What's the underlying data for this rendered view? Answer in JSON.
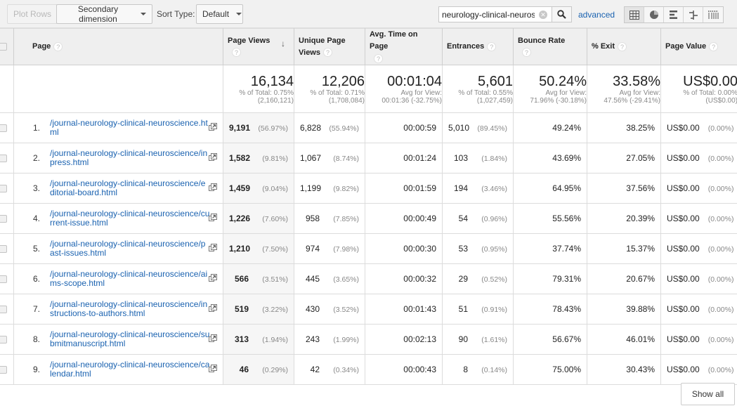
{
  "toolbar": {
    "plot_rows": "Plot Rows",
    "secondary_dimension": "Secondary dimension",
    "sort_type_label": "Sort Type:",
    "sort_type_value": "Default",
    "search_value": "neurology-clinical-neurosc",
    "advanced": "advanced",
    "view_modes": [
      "table",
      "pie",
      "performance",
      "comparison",
      "pivot"
    ],
    "active_view": "table"
  },
  "columns": {
    "page": "Page",
    "pageviews": "Page Views",
    "unique": "Unique Page Views",
    "avg_time": "Avg. Time on Page",
    "entrances": "Entrances",
    "bounce": "Bounce Rate",
    "exit": "% Exit",
    "value": "Page Value"
  },
  "summary": {
    "pageviews": {
      "value": "16,134",
      "line1": "% of Total: 0.75%",
      "line2": "(2,160,121)"
    },
    "unique": {
      "value": "12,206",
      "line1": "% of Total: 0.71%",
      "line2": "(1,708,084)"
    },
    "avg_time": {
      "value": "00:01:04",
      "line1": "Avg for View:",
      "line2": "00:01:36 (-32.75%)"
    },
    "entrances": {
      "value": "5,601",
      "line1": "% of Total: 0.55%",
      "line2": "(1,027,459)"
    },
    "bounce": {
      "value": "50.24%",
      "line1": "Avg for View:",
      "line2": "71.96% (-30.18%)"
    },
    "exit": {
      "value": "33.58%",
      "line1": "Avg for View:",
      "line2": "47.56% (-29.41%)"
    },
    "value": {
      "value": "US$0.00",
      "line1": "% of Total: 0.00%",
      "line2": "(US$0.00)"
    }
  },
  "rows": [
    {
      "idx": "1.",
      "page": "/journal-neurology-clinical-neuroscience.html",
      "pv": "9,191",
      "pv_pct": "(56.97%)",
      "upv": "6,828",
      "upv_pct": "(55.94%)",
      "time": "00:00:59",
      "ent": "5,010",
      "ent_pct": "(89.45%)",
      "bounce": "49.24%",
      "exit": "38.25%",
      "val": "US$0.00",
      "val_pct": "(0.00%)"
    },
    {
      "idx": "2.",
      "page": "/journal-neurology-clinical-neuroscience/inpress.html",
      "pv": "1,582",
      "pv_pct": "(9.81%)",
      "upv": "1,067",
      "upv_pct": "(8.74%)",
      "time": "00:01:24",
      "ent": "103",
      "ent_pct": "(1.84%)",
      "bounce": "43.69%",
      "exit": "27.05%",
      "val": "US$0.00",
      "val_pct": "(0.00%)"
    },
    {
      "idx": "3.",
      "page": "/journal-neurology-clinical-neuroscience/editorial-board.html",
      "pv": "1,459",
      "pv_pct": "(9.04%)",
      "upv": "1,199",
      "upv_pct": "(9.82%)",
      "time": "00:01:59",
      "ent": "194",
      "ent_pct": "(3.46%)",
      "bounce": "64.95%",
      "exit": "37.56%",
      "val": "US$0.00",
      "val_pct": "(0.00%)"
    },
    {
      "idx": "4.",
      "page": "/journal-neurology-clinical-neuroscience/current-issue.html",
      "pv": "1,226",
      "pv_pct": "(7.60%)",
      "upv": "958",
      "upv_pct": "(7.85%)",
      "time": "00:00:49",
      "ent": "54",
      "ent_pct": "(0.96%)",
      "bounce": "55.56%",
      "exit": "20.39%",
      "val": "US$0.00",
      "val_pct": "(0.00%)"
    },
    {
      "idx": "5.",
      "page": "/journal-neurology-clinical-neuroscience/past-issues.html",
      "pv": "1,210",
      "pv_pct": "(7.50%)",
      "upv": "974",
      "upv_pct": "(7.98%)",
      "time": "00:00:30",
      "ent": "53",
      "ent_pct": "(0.95%)",
      "bounce": "37.74%",
      "exit": "15.37%",
      "val": "US$0.00",
      "val_pct": "(0.00%)"
    },
    {
      "idx": "6.",
      "page": "/journal-neurology-clinical-neuroscience/aims-scope.html",
      "pv": "566",
      "pv_pct": "(3.51%)",
      "upv": "445",
      "upv_pct": "(3.65%)",
      "time": "00:00:32",
      "ent": "29",
      "ent_pct": "(0.52%)",
      "bounce": "79.31%",
      "exit": "20.67%",
      "val": "US$0.00",
      "val_pct": "(0.00%)"
    },
    {
      "idx": "7.",
      "page": "/journal-neurology-clinical-neuroscience/instructions-to-authors.html",
      "pv": "519",
      "pv_pct": "(3.22%)",
      "upv": "430",
      "upv_pct": "(3.52%)",
      "time": "00:01:43",
      "ent": "51",
      "ent_pct": "(0.91%)",
      "bounce": "78.43%",
      "exit": "39.88%",
      "val": "US$0.00",
      "val_pct": "(0.00%)"
    },
    {
      "idx": "8.",
      "page": "/journal-neurology-clinical-neuroscience/submitmanuscript.html",
      "pv": "313",
      "pv_pct": "(1.94%)",
      "upv": "243",
      "upv_pct": "(1.99%)",
      "time": "00:02:13",
      "ent": "90",
      "ent_pct": "(1.61%)",
      "bounce": "56.67%",
      "exit": "46.01%",
      "val": "US$0.00",
      "val_pct": "(0.00%)"
    },
    {
      "idx": "9.",
      "page": "/journal-neurology-clinical-neuroscience/calendar.html",
      "pv": "46",
      "pv_pct": "(0.29%)",
      "upv": "42",
      "upv_pct": "(0.34%)",
      "time": "00:00:43",
      "ent": "8",
      "ent_pct": "(0.14%)",
      "bounce": "75.00%",
      "exit": "30.43%",
      "val": "US$0.00",
      "val_pct": "(0.00%)"
    }
  ],
  "footer": {
    "show_all": "Show all"
  }
}
